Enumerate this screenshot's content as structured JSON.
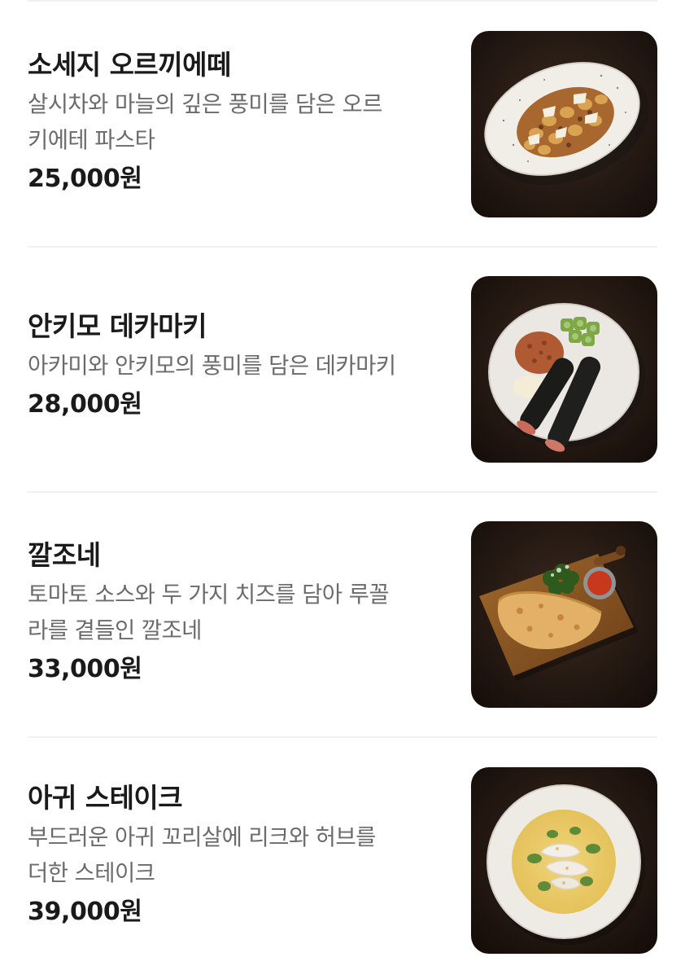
{
  "menu": {
    "items": [
      {
        "name": "소세지 오르끼에떼",
        "description": "살시차와 마늘의 깊은 풍미를 담은 오르키에테 파스타",
        "description_lines": [
          "살시차와 마늘의 깊은 풍미를 담은 오르",
          "키에테 파스타"
        ],
        "price": "25,000원",
        "image_icon": "pasta-dish-image"
      },
      {
        "name": "안키모 데카마키",
        "description": "아카미와 안키모의 풍미를 담은 데카마키",
        "description_lines": [
          "아카미와 안키모의 풍미를 담은 데카마키"
        ],
        "price": "28,000원",
        "image_icon": "sushi-roll-dish-image"
      },
      {
        "name": "깔조네",
        "description": "토마토 소스와 두 가지 치즈를 담아 루꼴라를 곁들인 깔조네",
        "description_lines": [
          "토마토 소스와 두 가지 치즈를 담아 루꼴",
          "라를 곁들인 깔조네"
        ],
        "price": "33,000원",
        "image_icon": "calzone-dish-image"
      },
      {
        "name": "아귀 스테이크",
        "description": "부드러운 아귀 꼬리살에 리크와 허브를 더한 스테이크",
        "description_lines": [
          "부드러운 아귀 꼬리살에 리크와 허브를",
          "더한 스테이크"
        ],
        "price": "39,000원",
        "image_icon": "monkfish-steak-dish-image"
      }
    ]
  },
  "colors": {
    "background": "#ffffff",
    "title_text": "#1a1a1a",
    "description_text": "#6b6b6b",
    "divider": "#f0f0f0",
    "photo_background": "#2a1c15"
  }
}
